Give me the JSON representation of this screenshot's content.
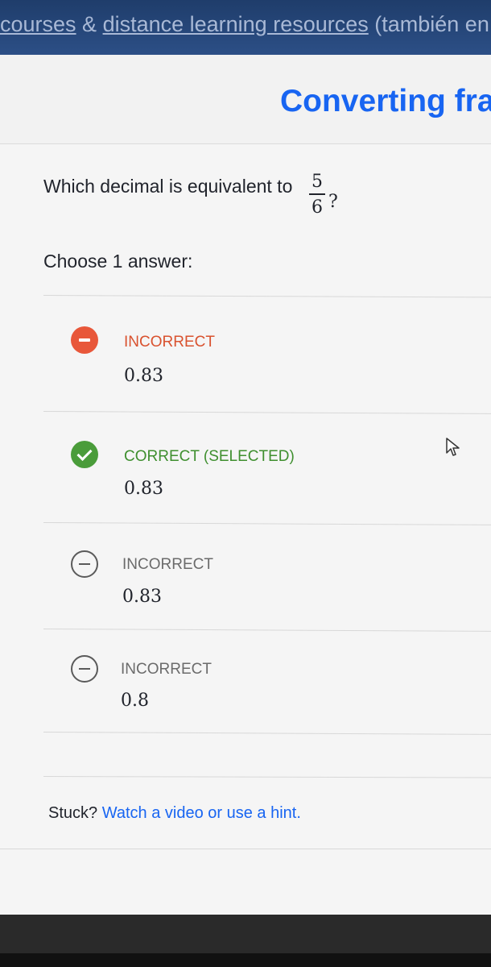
{
  "banner": {
    "link1": "courses",
    "separator": " & ",
    "link2": "distance learning resources",
    "tail": " (también en"
  },
  "header": {
    "title": "Converting fra"
  },
  "question": {
    "prompt": "Which decimal is equivalent to",
    "fraction_numerator": "5",
    "fraction_denominator": "6",
    "suffix": "?"
  },
  "choose_label": "Choose 1 answer:",
  "choices": [
    {
      "status": "INCORRECT",
      "value": "0.83",
      "icon": "minus-filled-icon",
      "color": "#e8573a"
    },
    {
      "status": "CORRECT (SELECTED)",
      "value": "0.83",
      "icon": "check-icon",
      "color": "#4a9c3a"
    },
    {
      "status": "INCORRECT",
      "value": "0.83",
      "icon": "minus-outline-icon",
      "color": "#5a5a5a"
    },
    {
      "status": "INCORRECT",
      "value": "0.8",
      "icon": "minus-outline-icon",
      "color": "#5a5a5a"
    }
  ],
  "help": {
    "prefix": "Stuck?",
    "link": "Watch a video or use a hint."
  },
  "colors": {
    "accent": "#1865f2",
    "incorrect": "#e8573a",
    "correct": "#4a9c3a"
  }
}
